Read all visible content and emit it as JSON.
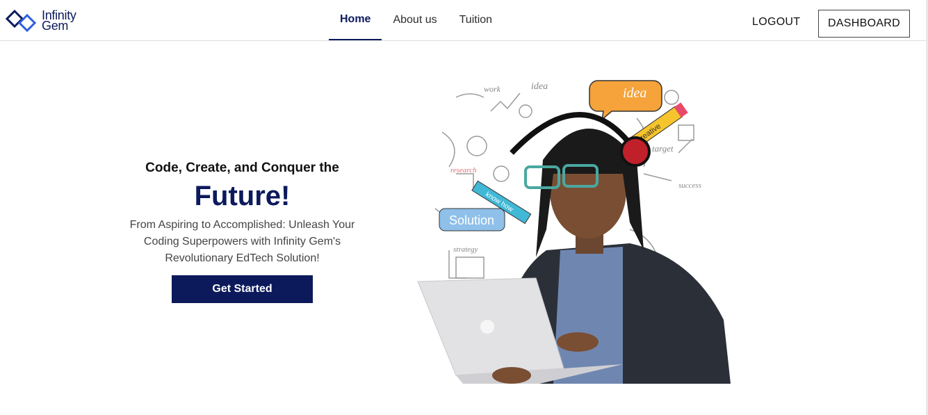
{
  "brand": {
    "name_line1": "Infinity",
    "name_line2": "Gem",
    "primary_color": "#0c1a5c"
  },
  "nav": {
    "items": [
      {
        "label": "Home",
        "active": true
      },
      {
        "label": "About us",
        "active": false
      },
      {
        "label": "Tuition",
        "active": false
      }
    ]
  },
  "header_actions": {
    "logout_label": "LOGOUT",
    "dashboard_label": "DASHBOARD"
  },
  "hero": {
    "tagline": "Code, Create, and Conquer the",
    "headline": "Future!",
    "subtitle": "From Aspiring to Accomplished: Unleash Your Coding Superpowers with Infinity Gem's Revolutionary EdTech Solution!",
    "cta_label": "Get Started"
  },
  "illustration": {
    "doodle_words": [
      "work",
      "idea",
      "idea",
      "creative",
      "target",
      "research",
      "know how",
      "Solution",
      "strategy",
      "success"
    ]
  }
}
